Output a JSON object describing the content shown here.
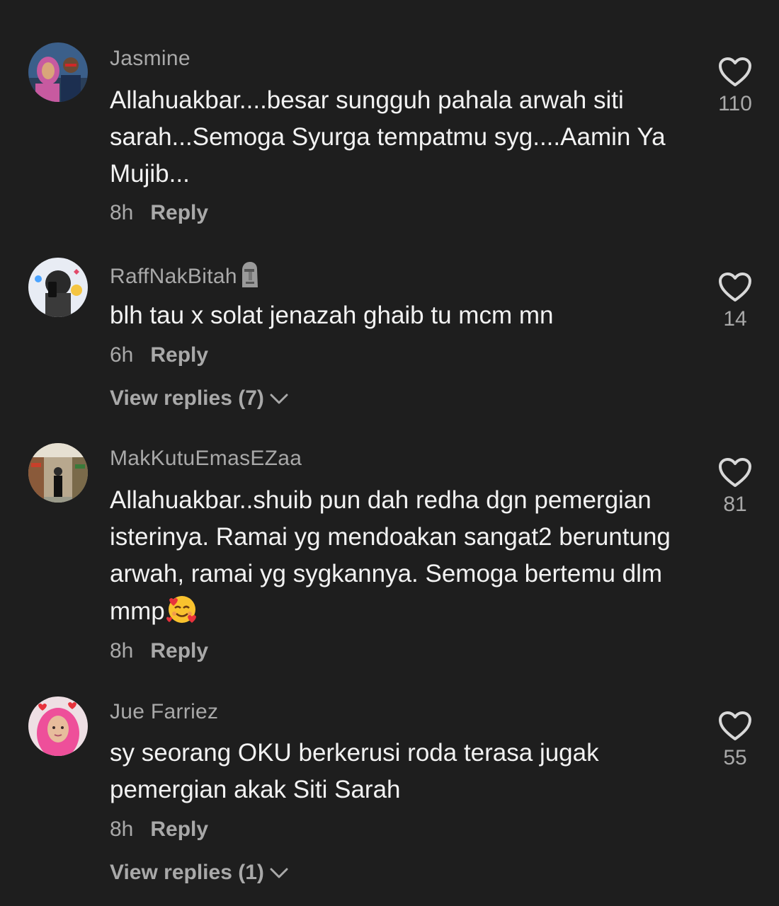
{
  "colors": {
    "background": "#1e1e1e",
    "text": "#f2f2f2",
    "muted": "#a9a9a9"
  },
  "comments": [
    {
      "username": "Jasmine",
      "text": "Allahuakbar....besar sungguh pahala arwah siti sarah...Semoga Syurga tempatmu syg....Aamin Ya Mujib...",
      "time": "8h",
      "reply_label": "Reply",
      "like_count": "110"
    },
    {
      "username": "RaffNakBitah",
      "username_emoji": "moai-emoji",
      "text": "blh tau x solat jenazah ghaib tu mcm mn",
      "time": "6h",
      "reply_label": "Reply",
      "like_count": "14",
      "view_replies": "View replies (7)"
    },
    {
      "username": "MakKutuEmasEZaa",
      "text": "Allahuakbar..shuib pun dah redha dgn pemergian isterinya. Ramai yg mendoakan sangat2 beruntung arwah, ramai yg sygkannya. Semoga bertemu dlm mmp",
      "text_emoji": "smiling-face-with-hearts-emoji",
      "time": "8h",
      "reply_label": "Reply",
      "like_count": "81"
    },
    {
      "username": "Jue Farriez",
      "text": "sy seorang OKU berkerusi roda terasa jugak pemergian akak Siti Sarah",
      "time": "8h",
      "reply_label": "Reply",
      "like_count": "55",
      "view_replies": "View replies (1)"
    }
  ]
}
